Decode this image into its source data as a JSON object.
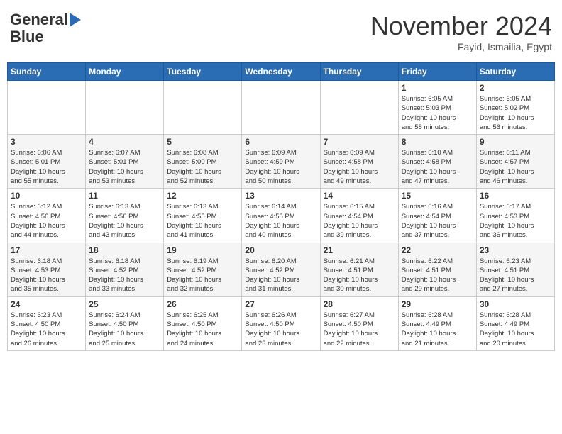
{
  "header": {
    "logo_general": "General",
    "logo_blue": "Blue",
    "month_title": "November 2024",
    "location": "Fayid, Ismailia, Egypt"
  },
  "calendar": {
    "days_of_week": [
      "Sunday",
      "Monday",
      "Tuesday",
      "Wednesday",
      "Thursday",
      "Friday",
      "Saturday"
    ],
    "weeks": [
      [
        {
          "day": "",
          "info": ""
        },
        {
          "day": "",
          "info": ""
        },
        {
          "day": "",
          "info": ""
        },
        {
          "day": "",
          "info": ""
        },
        {
          "day": "",
          "info": ""
        },
        {
          "day": "1",
          "info": "Sunrise: 6:05 AM\nSunset: 5:03 PM\nDaylight: 10 hours\nand 58 minutes."
        },
        {
          "day": "2",
          "info": "Sunrise: 6:05 AM\nSunset: 5:02 PM\nDaylight: 10 hours\nand 56 minutes."
        }
      ],
      [
        {
          "day": "3",
          "info": "Sunrise: 6:06 AM\nSunset: 5:01 PM\nDaylight: 10 hours\nand 55 minutes."
        },
        {
          "day": "4",
          "info": "Sunrise: 6:07 AM\nSunset: 5:01 PM\nDaylight: 10 hours\nand 53 minutes."
        },
        {
          "day": "5",
          "info": "Sunrise: 6:08 AM\nSunset: 5:00 PM\nDaylight: 10 hours\nand 52 minutes."
        },
        {
          "day": "6",
          "info": "Sunrise: 6:09 AM\nSunset: 4:59 PM\nDaylight: 10 hours\nand 50 minutes."
        },
        {
          "day": "7",
          "info": "Sunrise: 6:09 AM\nSunset: 4:58 PM\nDaylight: 10 hours\nand 49 minutes."
        },
        {
          "day": "8",
          "info": "Sunrise: 6:10 AM\nSunset: 4:58 PM\nDaylight: 10 hours\nand 47 minutes."
        },
        {
          "day": "9",
          "info": "Sunrise: 6:11 AM\nSunset: 4:57 PM\nDaylight: 10 hours\nand 46 minutes."
        }
      ],
      [
        {
          "day": "10",
          "info": "Sunrise: 6:12 AM\nSunset: 4:56 PM\nDaylight: 10 hours\nand 44 minutes."
        },
        {
          "day": "11",
          "info": "Sunrise: 6:13 AM\nSunset: 4:56 PM\nDaylight: 10 hours\nand 43 minutes."
        },
        {
          "day": "12",
          "info": "Sunrise: 6:13 AM\nSunset: 4:55 PM\nDaylight: 10 hours\nand 41 minutes."
        },
        {
          "day": "13",
          "info": "Sunrise: 6:14 AM\nSunset: 4:55 PM\nDaylight: 10 hours\nand 40 minutes."
        },
        {
          "day": "14",
          "info": "Sunrise: 6:15 AM\nSunset: 4:54 PM\nDaylight: 10 hours\nand 39 minutes."
        },
        {
          "day": "15",
          "info": "Sunrise: 6:16 AM\nSunset: 4:54 PM\nDaylight: 10 hours\nand 37 minutes."
        },
        {
          "day": "16",
          "info": "Sunrise: 6:17 AM\nSunset: 4:53 PM\nDaylight: 10 hours\nand 36 minutes."
        }
      ],
      [
        {
          "day": "17",
          "info": "Sunrise: 6:18 AM\nSunset: 4:53 PM\nDaylight: 10 hours\nand 35 minutes."
        },
        {
          "day": "18",
          "info": "Sunrise: 6:18 AM\nSunset: 4:52 PM\nDaylight: 10 hours\nand 33 minutes."
        },
        {
          "day": "19",
          "info": "Sunrise: 6:19 AM\nSunset: 4:52 PM\nDaylight: 10 hours\nand 32 minutes."
        },
        {
          "day": "20",
          "info": "Sunrise: 6:20 AM\nSunset: 4:52 PM\nDaylight: 10 hours\nand 31 minutes."
        },
        {
          "day": "21",
          "info": "Sunrise: 6:21 AM\nSunset: 4:51 PM\nDaylight: 10 hours\nand 30 minutes."
        },
        {
          "day": "22",
          "info": "Sunrise: 6:22 AM\nSunset: 4:51 PM\nDaylight: 10 hours\nand 29 minutes."
        },
        {
          "day": "23",
          "info": "Sunrise: 6:23 AM\nSunset: 4:51 PM\nDaylight: 10 hours\nand 27 minutes."
        }
      ],
      [
        {
          "day": "24",
          "info": "Sunrise: 6:23 AM\nSunset: 4:50 PM\nDaylight: 10 hours\nand 26 minutes."
        },
        {
          "day": "25",
          "info": "Sunrise: 6:24 AM\nSunset: 4:50 PM\nDaylight: 10 hours\nand 25 minutes."
        },
        {
          "day": "26",
          "info": "Sunrise: 6:25 AM\nSunset: 4:50 PM\nDaylight: 10 hours\nand 24 minutes."
        },
        {
          "day": "27",
          "info": "Sunrise: 6:26 AM\nSunset: 4:50 PM\nDaylight: 10 hours\nand 23 minutes."
        },
        {
          "day": "28",
          "info": "Sunrise: 6:27 AM\nSunset: 4:50 PM\nDaylight: 10 hours\nand 22 minutes."
        },
        {
          "day": "29",
          "info": "Sunrise: 6:28 AM\nSunset: 4:49 PM\nDaylight: 10 hours\nand 21 minutes."
        },
        {
          "day": "30",
          "info": "Sunrise: 6:28 AM\nSunset: 4:49 PM\nDaylight: 10 hours\nand 20 minutes."
        }
      ]
    ]
  }
}
